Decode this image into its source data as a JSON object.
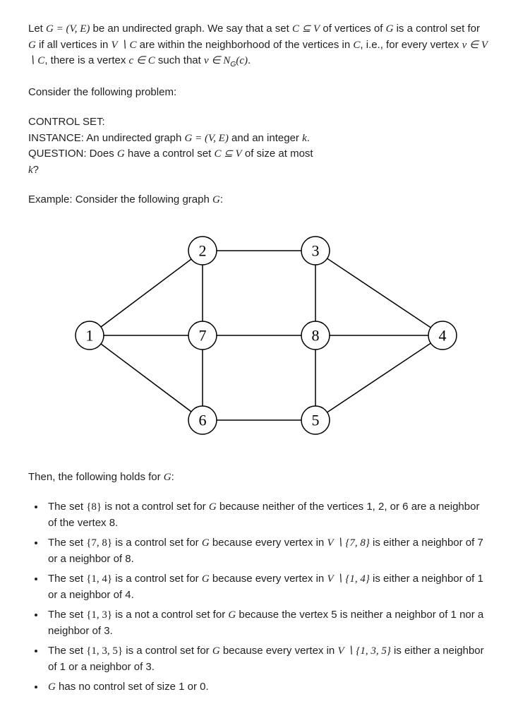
{
  "p_intro_1": "Let ",
  "m_GVE": "G = (V, E)",
  "p_intro_2": " be an undirected graph. We say that a set ",
  "m_CsubV": "C ⊆ V",
  "p_intro_3": " of vertices of ",
  "m_G": "G",
  "p_intro_4": " is a control set for ",
  "p_intro_5": " if all vertices in ",
  "m_VminusC": "V ∖ C",
  "p_intro_6": " are within the neighborhood of the vertices in ",
  "m_C": "C",
  "p_intro_7": ", i.e., for every vertex ",
  "m_vinVC": "v ∈ V ∖ C",
  "p_intro_8": ", there is a vertex ",
  "m_cinC": "c ∈ C",
  "p_intro_9": " such that ",
  "m_vinNGc_a": "v ∈ N",
  "m_vinNGc_sub": "G",
  "m_vinNGc_b": "(c)",
  "p_intro_10": ".",
  "p_consider": "Consider the following problem:",
  "p_cs_title": "CONTROL SET:",
  "p_inst_1": "INSTANCE: An undirected graph ",
  "p_inst_2": " and an integer ",
  "m_k": "k",
  "p_inst_3": ".",
  "p_q_1": "QUESTION: Does ",
  "p_q_2": " have a control set ",
  "p_q_3": " of size at most",
  "p_kq": "k?",
  "p_example": "Example: Consider the following graph ",
  "p_example_end": ":",
  "graph_labels": {
    "n1": "1",
    "n2": "2",
    "n3": "3",
    "n4": "4",
    "n5": "5",
    "n6": "6",
    "n7": "7",
    "n8": "8"
  },
  "p_then": "Then, the following holds for ",
  "b1_a": "The set ",
  "m_b1": "{8}",
  "b1_b": " is not a control set for ",
  "b1_c": " because neither of the vertices   1, 2, or 6 are a neighbor of the vertex 8.",
  "b2_a": "The set ",
  "m_b2": "{7, 8}",
  "b2_b": " is a control set for ",
  "b2_c": " because every vertex in ",
  "m_b2v": "V ∖ {7, 8}",
  "b2_d": " is either a neighbor of 7 or a neighbor of 8.",
  "b3_a": "The set ",
  "m_b3": "{1, 4}",
  "b3_b": " is a control set for ",
  "b3_c": " because every vertex in ",
  "m_b3v": "V ∖ {1, 4}",
  "b3_d": " is either a neighbor of 1 or a neighbor of 4.",
  "b4_a": "The set ",
  "m_b4": "{1, 3}",
  "b4_b": " is a not a control set for ",
  "b4_c": " because the vertex 5 is neither a neighbor of 1 nor a neighbor of 3.",
  "b5_a": "The set ",
  "m_b5": "{1, 3, 5}",
  "b5_b": " is a control set for ",
  "b5_c": " because every vertex in ",
  "m_b5v": "V ∖ {1, 3, 5}",
  "b5_d": " is either a neighbor of 1 or a neighbor of 3.",
  "b6_a": "",
  "b6_b": " has no control set of size 1 or 0."
}
